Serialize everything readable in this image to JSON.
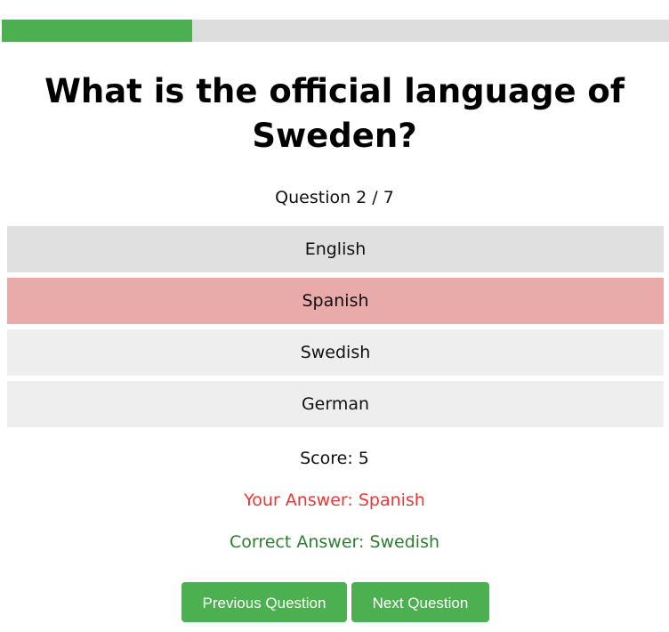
{
  "progress": {
    "current": 2,
    "total": 7,
    "fill_color": "#4caf50",
    "track_color": "#dddddd"
  },
  "question": {
    "title_line1": "What is the official language of",
    "title_line2": "Sweden?",
    "counter": "Question 2 / 7"
  },
  "options": [
    {
      "label": "English",
      "state": "hovered"
    },
    {
      "label": "Spanish",
      "state": "wrong"
    },
    {
      "label": "Swedish",
      "state": "normal"
    },
    {
      "label": "German",
      "state": "normal"
    }
  ],
  "result": {
    "score": "Score: 5",
    "your_answer": "Your Answer: Spanish",
    "your_answer_color": "#e53935",
    "correct_answer": "Correct Answer: Swedish",
    "correct_answer_color": "#2e7d32"
  },
  "buttons": {
    "previous": "Previous Question",
    "next": "Next Question",
    "color": "#4caf50"
  }
}
